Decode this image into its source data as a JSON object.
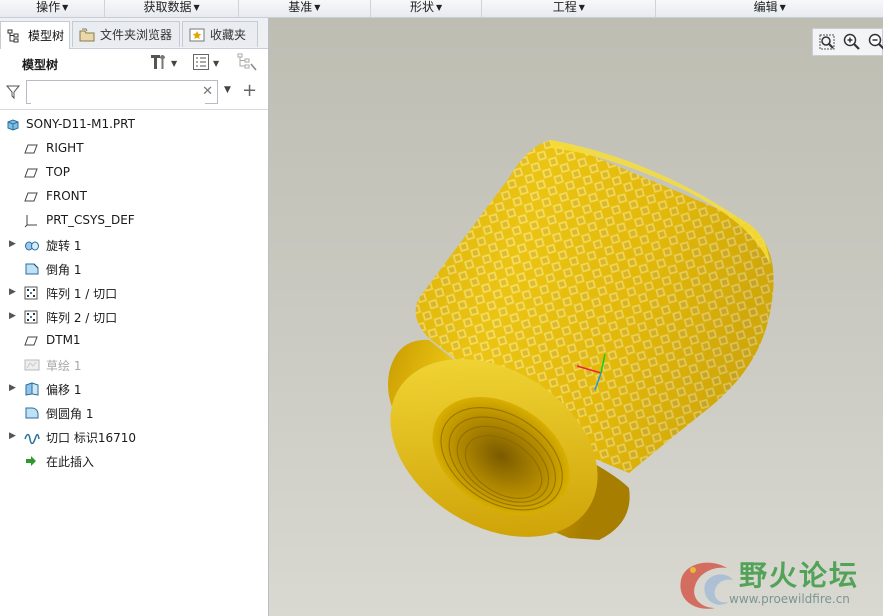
{
  "ribbon": {
    "groups": [
      {
        "label": "操作"
      },
      {
        "label": "获取数据"
      },
      {
        "label": "基准"
      },
      {
        "label": "形状"
      },
      {
        "label": "工程"
      },
      {
        "label": "编辑"
      }
    ]
  },
  "tabs": [
    {
      "label": "模型树",
      "icon": "model-tree-icon"
    },
    {
      "label": "文件夹浏览器",
      "icon": "folder-browser-icon"
    },
    {
      "label": "收藏夹",
      "icon": "favorites-icon"
    }
  ],
  "toolbar": {
    "title": "模型树"
  },
  "filter": {
    "value": "",
    "placeholder": ""
  },
  "tree": {
    "root": {
      "label": "SONY-D11-M1.PRT",
      "icon": "part-icon"
    },
    "items": [
      {
        "label": "RIGHT",
        "icon": "datum-plane-icon",
        "expandable": false,
        "dim": false
      },
      {
        "label": "TOP",
        "icon": "datum-plane-icon",
        "expandable": false,
        "dim": false
      },
      {
        "label": "FRONT",
        "icon": "datum-plane-icon",
        "expandable": false,
        "dim": false
      },
      {
        "label": "PRT_CSYS_DEF",
        "icon": "coordinate-system-icon",
        "expandable": false,
        "dim": false
      },
      {
        "label": "旋转 1",
        "icon": "revolve-icon",
        "expandable": true,
        "dim": false
      },
      {
        "label": "倒角 1",
        "icon": "chamfer-icon",
        "expandable": false,
        "dim": false
      },
      {
        "label": "阵列 1 / 切口",
        "icon": "pattern-icon",
        "expandable": true,
        "dim": false
      },
      {
        "label": "阵列 2 / 切口",
        "icon": "pattern-icon",
        "expandable": true,
        "dim": false
      },
      {
        "label": "DTM1",
        "icon": "datum-plane-icon",
        "expandable": false,
        "dim": false
      },
      {
        "label": "草绘 1",
        "icon": "sketch-icon",
        "expandable": false,
        "dim": true
      },
      {
        "label": "偏移 1",
        "icon": "offset-icon",
        "expandable": true,
        "dim": false
      },
      {
        "label": "倒圆角 1",
        "icon": "round-icon",
        "expandable": false,
        "dim": false
      },
      {
        "label": "切口 标识16710",
        "icon": "cut-icon",
        "expandable": true,
        "dim": false
      },
      {
        "label": "在此插入",
        "icon": "insert-here-arrow-icon",
        "expandable": false,
        "dim": false
      }
    ]
  },
  "viewbar": {
    "icons": [
      "refit-icon",
      "zoom-in-icon",
      "zoom-out-icon"
    ]
  },
  "watermark": {
    "title": "野火论坛",
    "url": "www.proewildfire.cn"
  },
  "colors": {
    "model_gold": "#e2b900",
    "viewport_bg": "#c9c9c0",
    "insert_arrow": "#2e9a2e"
  }
}
